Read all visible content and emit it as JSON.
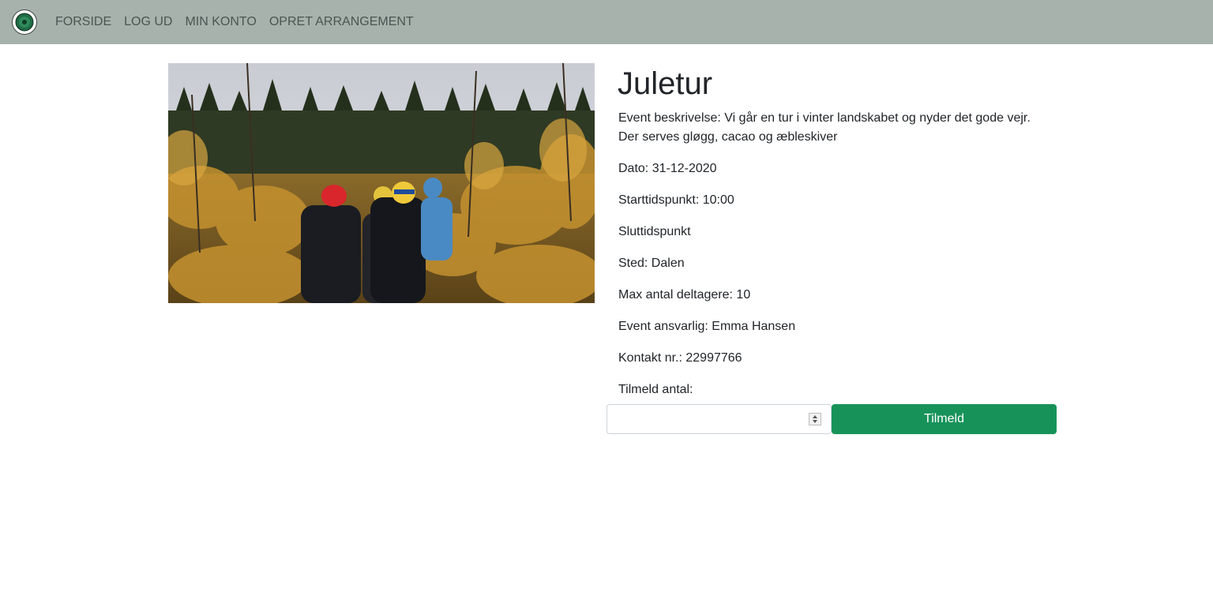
{
  "nav": {
    "items": [
      "FORSIDE",
      "LOG UD",
      "MIN KONTO",
      "OPRET ARRANGEMENT"
    ]
  },
  "event": {
    "title": "Juletur",
    "description_line1": "Event beskrivelse: Vi går en tur i vinter landskabet og nyder det gode vejr.",
    "description_line2": "Der serves gløgg, cacao og æbleskiver",
    "date": "Dato: 31-12-2020",
    "start": "Starttidspunkt: 10:00",
    "end": "Sluttidspunkt",
    "place": "Sted: Dalen",
    "max": "Max antal deltagere: 10",
    "responsible": "Event ansvarlig: Emma Hansen",
    "contact": "Kontakt nr.: 22997766",
    "signup_label": "Tilmeld antal:"
  },
  "form": {
    "quantity_value": "",
    "button_label": "Tilmeld"
  },
  "colors": {
    "navbar": "#a7b2ad",
    "button": "#17935a"
  }
}
